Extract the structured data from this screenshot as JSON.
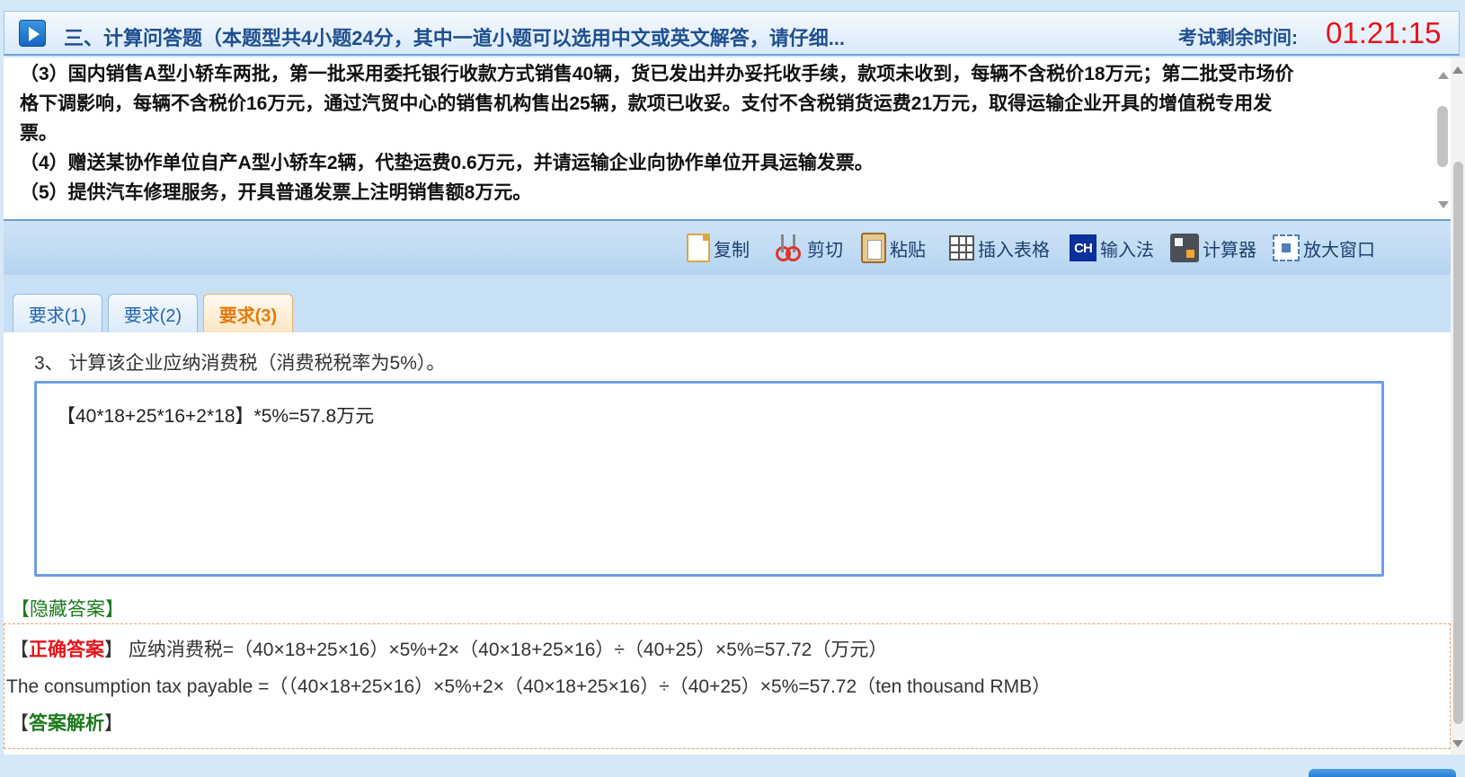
{
  "header": {
    "section_title": "三、计算问答题（本题型共4小题24分，其中一道小题可以选用中文或英文解答，请仔细...",
    "timer_label": "考试剩余时间:",
    "timer_value": "01:21:15"
  },
  "question": {
    "lines": [
      "（3）国内销售A型小轿车两批，第一批采用委托银行收款方式销售40辆，货已发出并办妥托收手续，款项未收到，每辆不含税价18万元；第二批受市场价",
      "格下调影响，每辆不含税价16万元，通过汽贸中心的销售机构售出25辆，款项已收妥。支付不含税销货运费21万元，取得运输企业开具的增值税专用发",
      "票。",
      "（4）赠送某协作单位自产A型小轿车2辆，代垫运费0.6万元，并请运输企业向协作单位开具运输发票。",
      "（5）提供汽车修理服务，开具普通发票上注明销售额8万元。"
    ]
  },
  "toolbar": {
    "copy": "复制",
    "cut": "剪切",
    "paste": "粘贴",
    "insert_table": "插入表格",
    "ime": "输入法",
    "ime_badge": "CH",
    "calculator": "计算器",
    "maximize": "放大窗口"
  },
  "tabs": [
    {
      "label": "要求(1)"
    },
    {
      "label": "要求(2)"
    },
    {
      "label": "要求(3)"
    }
  ],
  "active_tab": 2,
  "content": {
    "prompt": "3、 计算该企业应纳消费税（消费税税率为5%）。",
    "answer_value": "【40*18+25*16+2*18】*5%=57.8万元",
    "hide_answer": "【隐藏答案】",
    "correct_label": "正确答案",
    "correct_cn": "应纳消费税=（40×18+25×16）×5%+2×（40×18+25×16）÷（40+25）×5%=57.72（万元）",
    "correct_en": "The consumption tax payable =（（40×18+25×16）×5%+2×（40×18+25×16）÷（40+25）×5%=57.72（ten thousand RMB）",
    "analysis_label": "答案解析"
  },
  "colors": {
    "timer": "#e8141a",
    "active_tab": "#e57a0c",
    "link_green": "#1c7a1c",
    "answer_border": "#6c9ee8"
  }
}
